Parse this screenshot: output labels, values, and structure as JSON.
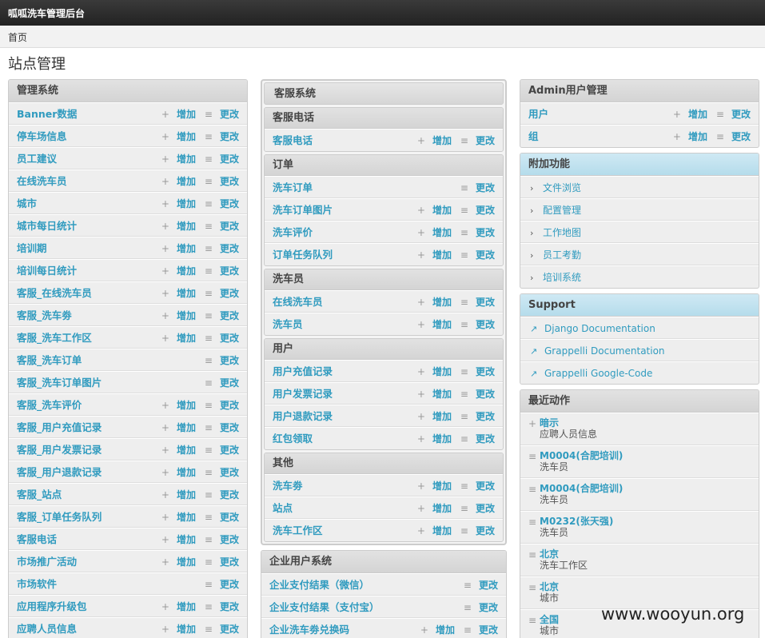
{
  "header": {
    "brand": "呱呱洗车管理后台"
  },
  "breadcrumb": {
    "home": "首页"
  },
  "page": {
    "title": "站点管理"
  },
  "labels": {
    "add": "增加",
    "change": "更改"
  },
  "col1": {
    "title": "管理系统",
    "rows": [
      {
        "name": "Banner数据",
        "add": true
      },
      {
        "name": "停车场信息",
        "add": true
      },
      {
        "name": "员工建议",
        "add": true
      },
      {
        "name": "在线洗车员",
        "add": true
      },
      {
        "name": "城市",
        "add": true
      },
      {
        "name": "城市每日统计",
        "add": true
      },
      {
        "name": "培训期",
        "add": true
      },
      {
        "name": "培训每日统计",
        "add": true
      },
      {
        "name": "客服_在线洗车员",
        "add": true
      },
      {
        "name": "客服_洗车劵",
        "add": true
      },
      {
        "name": "客服_洗车工作区",
        "add": true
      },
      {
        "name": "客服_洗车订单",
        "add": false
      },
      {
        "name": "客服_洗车订单图片",
        "add": false
      },
      {
        "name": "客服_洗车评价",
        "add": true
      },
      {
        "name": "客服_用户充值记录",
        "add": true
      },
      {
        "name": "客服_用户发票记录",
        "add": true
      },
      {
        "name": "客服_用户退款记录",
        "add": true
      },
      {
        "name": "客服_站点",
        "add": true
      },
      {
        "name": "客服_订单任务队列",
        "add": true
      },
      {
        "name": "客服电话",
        "add": true
      },
      {
        "name": "市场推广活动",
        "add": true
      },
      {
        "name": "市场软件",
        "add": false
      },
      {
        "name": "应用程序升级包",
        "add": true
      },
      {
        "name": "应聘人员信息",
        "add": true
      }
    ]
  },
  "col2": {
    "group_title": "客服系统",
    "modules": [
      {
        "title": "客服电话",
        "rows": [
          {
            "name": "客服电话",
            "add": true
          }
        ]
      },
      {
        "title": "订单",
        "rows": [
          {
            "name": "洗车订单",
            "add": false
          },
          {
            "name": "洗车订单图片",
            "add": true
          },
          {
            "name": "洗车评价",
            "add": true
          },
          {
            "name": "订单任务队列",
            "add": true
          }
        ]
      },
      {
        "title": "洗车员",
        "rows": [
          {
            "name": "在线洗车员",
            "add": true
          },
          {
            "name": "洗车员",
            "add": true
          }
        ]
      },
      {
        "title": "用户",
        "rows": [
          {
            "name": "用户充值记录",
            "add": true
          },
          {
            "name": "用户发票记录",
            "add": true
          },
          {
            "name": "用户退款记录",
            "add": true
          },
          {
            "name": "红包领取",
            "add": true
          }
        ]
      },
      {
        "title": "其他",
        "rows": [
          {
            "name": "洗车劵",
            "add": true
          },
          {
            "name": "站点",
            "add": true
          },
          {
            "name": "洗车工作区",
            "add": true
          }
        ]
      }
    ],
    "enterprise": {
      "title": "企业用户系统",
      "rows": [
        {
          "name": "企业支付结果（微信）",
          "add": false
        },
        {
          "name": "企业支付结果（支付宝）",
          "add": false
        },
        {
          "name": "企业洗车劵兑换码",
          "add": true
        }
      ]
    }
  },
  "col3": {
    "admin": {
      "title": "Admin用户管理",
      "rows": [
        {
          "name": "用户",
          "add": true
        },
        {
          "name": "组",
          "add": true
        }
      ]
    },
    "extra": {
      "title": "附加功能",
      "links": [
        "文件浏览",
        "配置管理",
        "工作地图",
        "员工考勤",
        "培训系统"
      ]
    },
    "support": {
      "title": "Support",
      "links": [
        "Django Documentation",
        "Grappelli Documentation",
        "Grappelli Google-Code"
      ]
    },
    "recent": {
      "title": "最近动作",
      "items": [
        {
          "icon": "plus-icon",
          "title": "暗示",
          "sub": "应聘人员信息"
        },
        {
          "icon": "change-icon",
          "title": "M0004(合肥培训)",
          "sub": "洗车员"
        },
        {
          "icon": "change-icon",
          "title": "M0004(合肥培训)",
          "sub": "洗车员"
        },
        {
          "icon": "change-icon",
          "title": "M0232(张天强)",
          "sub": "洗车员"
        },
        {
          "icon": "change-icon",
          "title": "北京",
          "sub": "洗车工作区"
        },
        {
          "icon": "change-icon",
          "title": "北京",
          "sub": "城市"
        },
        {
          "icon": "change-icon",
          "title": "全国",
          "sub": "城市"
        }
      ]
    }
  },
  "watermark": "www.wooyun.org"
}
